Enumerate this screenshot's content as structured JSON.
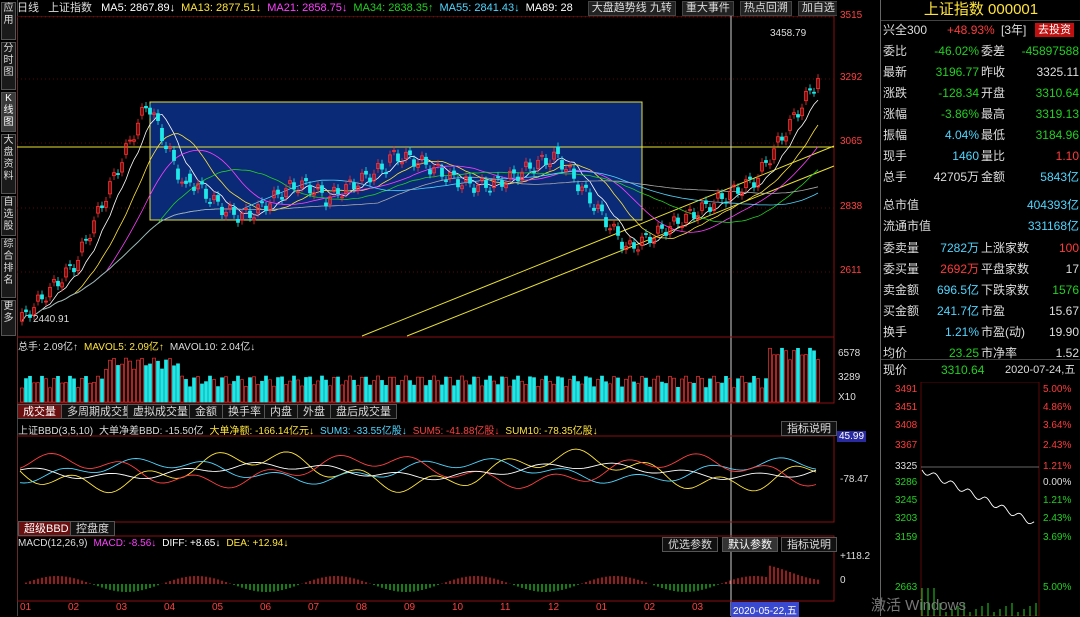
{
  "left_tabs": [
    {
      "label": "应用"
    },
    {
      "label": "分时图"
    },
    {
      "label": "K线图"
    },
    {
      "label": "大盘资料"
    },
    {
      "label": "自选股"
    },
    {
      "label": "综合排名"
    },
    {
      "label": "更多"
    }
  ],
  "top_bar": {
    "period": "日线",
    "index_name": "上证指数",
    "ma": [
      {
        "label": "MA5: 2867.89↓",
        "color": "#ffffff"
      },
      {
        "label": "MA13: 2877.51↓",
        "color": "#ffe43a"
      },
      {
        "label": "MA21: 2858.75↓",
        "color": "#ff40ff"
      },
      {
        "label": "MA34: 2838.35↑",
        "color": "#22d022"
      },
      {
        "label": "MA55: 2841.43↓",
        "color": "#4fd6ff"
      },
      {
        "label": "MA89: 28",
        "color": "#ffffff"
      }
    ],
    "buttons": [
      "大盘趋势线 九转",
      "重大事件",
      "热点回溯",
      "加自选",
      "均线",
      "简",
      "预测"
    ]
  },
  "main_chart": {
    "price_ticks": [
      "3515",
      "3292",
      "3065",
      "2838",
      "2611"
    ],
    "high_label": "3458.79",
    "low_label": "2440.91"
  },
  "volume_panel": {
    "header": [
      {
        "text": "总手: 2.09亿↑",
        "color": "#dddddd"
      },
      {
        "text": "MAVOL5: 2.09亿↑",
        "color": "#ffe43a"
      },
      {
        "text": "MAVOL10: 2.04亿↓",
        "color": "#dddddd"
      }
    ],
    "ticks": [
      "6578",
      "3289",
      "X10"
    ]
  },
  "indicator_tabs": [
    "成交量",
    "多周期成交量",
    "虚拟成交量",
    "金额",
    "换手率",
    "内盘",
    "外盘",
    "盘后成交量"
  ],
  "bbd_panel": {
    "header": [
      {
        "text": "上证BBD(3,5,10)",
        "color": "#dddddd"
      },
      {
        "text": "大单净差BBD: -15.50亿",
        "color": "#dddddd"
      },
      {
        "text": "大单净额: -166.14亿元↓",
        "color": "#ffe43a"
      },
      {
        "text": "SUM3: -33.55亿股↓",
        "color": "#4fd6ff"
      },
      {
        "text": "SUM5: -41.88亿股↓",
        "color": "#ff4040"
      },
      {
        "text": "SUM10: -78.35亿股↓",
        "color": "#ffe43a"
      }
    ],
    "explain_button": "指标说明",
    "tick_top": "45.99",
    "tick_mid": "-78.47"
  },
  "bbd_tabs": [
    "超级BBD",
    "控盘度"
  ],
  "macd_panel": {
    "header": [
      {
        "text": "MACD(12,26,9)",
        "color": "#dddddd"
      },
      {
        "text": "MACD: -8.56↓",
        "color": "#ff40ff"
      },
      {
        "text": "DIFF: +8.65↓",
        "color": "#ffffff"
      },
      {
        "text": "DEA: +12.94↓",
        "color": "#ffe43a"
      }
    ],
    "buttons": [
      "优选参数",
      "默认参数",
      "指标说明"
    ],
    "tick_top": "+118.2",
    "tick_zero": "0"
  },
  "x_axis": {
    "months": [
      "01",
      "02",
      "03",
      "04",
      "05",
      "06",
      "07",
      "08",
      "09",
      "10",
      "11",
      "12",
      "01",
      "02",
      "03",
      "04",
      "05"
    ],
    "cursor_date": "2020-05-22,五"
  },
  "right_panel": {
    "title": "上证指数 000001",
    "row_xq": {
      "label": "兴全300",
      "value": "+48.93%",
      "tag": "[3年]",
      "button": "去投资"
    },
    "rows": [
      {
        "l1": "委比",
        "v1": "-46.02%",
        "c1": "#22d022",
        "l2": "委差",
        "v2": "-45897588",
        "c2": "#22d022"
      },
      {
        "l1": "最新",
        "v1": "3196.77",
        "c1": "#22d022",
        "l2": "昨收",
        "v2": "3325.11",
        "c2": "#dddddd"
      },
      {
        "l1": "涨跌",
        "v1": "-128.34",
        "c1": "#22d022",
        "l2": "开盘",
        "v2": "3310.64",
        "c2": "#22d022"
      },
      {
        "l1": "涨幅",
        "v1": "-3.86%",
        "c1": "#22d022",
        "l2": "最高",
        "v2": "3319.13",
        "c2": "#22d022"
      },
      {
        "l1": "振幅",
        "v1": "4.04%",
        "c1": "#4fd6ff",
        "l2": "最低",
        "v2": "3184.96",
        "c2": "#22d022"
      },
      {
        "l1": "现手",
        "v1": "1460",
        "c1": "#4fd6ff",
        "l2": "量比",
        "v2": "1.10",
        "c2": "#ff3b3b"
      },
      {
        "l1": "总手",
        "v1": "42705万",
        "c1": "#dddddd",
        "l2": "金额",
        "v2": "5843亿",
        "c2": "#4fd6ff"
      }
    ],
    "mkt_cap": [
      {
        "label": "总市值",
        "value": "404393亿"
      },
      {
        "label": "流通市值",
        "value": "331168亿"
      }
    ],
    "rows2": [
      {
        "l1": "委卖量",
        "v1": "7282万",
        "c1": "#4fd6ff",
        "l2": "上涨家数",
        "v2": "100",
        "c2": "#ff3b3b"
      },
      {
        "l1": "委买量",
        "v1": "2692万",
        "c1": "#ff3b3b",
        "l2": "平盘家数",
        "v2": "17",
        "c2": "#dddddd"
      },
      {
        "l1": "卖金额",
        "v1": "696.5亿",
        "c1": "#4fd6ff",
        "l2": "下跌家数",
        "v2": "1576",
        "c2": "#22d022"
      },
      {
        "l1": "买金额",
        "v1": "241.7亿",
        "c1": "#4fd6ff",
        "l2": "市盈",
        "v2": "15.67",
        "c2": "#dddddd"
      },
      {
        "l1": "换手",
        "v1": "1.21%",
        "c1": "#4fd6ff",
        "l2": "市盈(动)",
        "v2": "19.90",
        "c2": "#dddddd"
      },
      {
        "l1": "均价",
        "v1": "23.25",
        "c1": "#22d022",
        "l2": "市净率",
        "v2": "1.52",
        "c2": "#dddddd"
      }
    ],
    "current_row": {
      "label": "现价",
      "value": "3310.64",
      "date": "2020-07-24,五"
    },
    "mini_left": [
      "3491",
      "3451",
      "3408",
      "3367",
      "3325",
      "3286",
      "3245",
      "3203",
      "3159",
      "2663"
    ],
    "mini_right": [
      "5.00%",
      "4.86%",
      "3.64%",
      "2.43%",
      "1.21%",
      "0.00%",
      "1.21%",
      "2.43%",
      "3.69%",
      "5.00%"
    ],
    "watermark": "激活 Windows"
  }
}
